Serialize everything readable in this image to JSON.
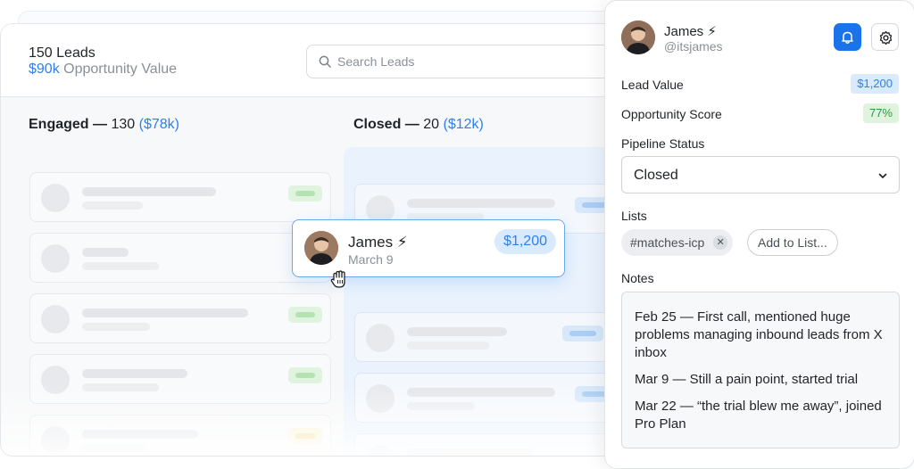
{
  "header": {
    "leads_count": "150 Leads",
    "opportunity_amount": "$90k",
    "opportunity_label": "Opportunity Value",
    "search_placeholder": "Search Leads"
  },
  "columns": [
    {
      "title": "Engaged —",
      "count": "130",
      "amount": "($78k)"
    },
    {
      "title": "Closed —",
      "count": "20",
      "amount": "($12k)"
    }
  ],
  "drag_card": {
    "name": "James ⚡",
    "date": "March 9",
    "value": "$1,200"
  },
  "panel": {
    "user_name": "James ⚡",
    "user_handle": "@itsjames",
    "lead_value_label": "Lead Value",
    "lead_value": "$1,200",
    "opportunity_score_label": "Opportunity Score",
    "opportunity_score": "77%",
    "pipeline_status_label": "Pipeline Status",
    "pipeline_status_value": "Closed",
    "lists_label": "Lists",
    "list_tags": [
      "#matches-icp"
    ],
    "add_to_list_label": "Add to List...",
    "notes_label": "Notes",
    "notes": [
      "Feb 25 — First call, mentioned huge problems managing inbound leads from X inbox",
      "Mar 9 — Still a pain point, started trial",
      "Mar 22 — “the trial blew me away”, joined Pro Plan"
    ]
  },
  "colors": {
    "accent": "#2f80ed",
    "primary_button": "#1a73e8",
    "green_badge": "#2f9a3a"
  }
}
